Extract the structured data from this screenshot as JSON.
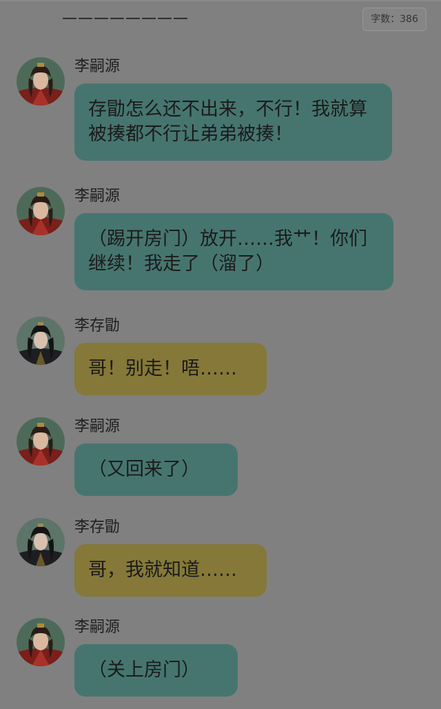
{
  "header": {
    "title_dashes": "————————",
    "word_count": "字数：386"
  },
  "messages": [
    {
      "speaker": "李嗣源",
      "text": "存勖怎么还不出来，不行！我就算被揍都不行让弟弟被揍！",
      "avatar_icon": "avatar-red-robed-man-icon",
      "bubble_color": "#46756f"
    },
    {
      "speaker": "李嗣源",
      "text": "（踢开房门）放开……我艹！你们继续！我走了（溜了）",
      "avatar_icon": "avatar-red-robed-man-icon",
      "bubble_color": "#46756f"
    },
    {
      "speaker": "李存勖",
      "text": "哥！别走！唔……",
      "avatar_icon": "avatar-black-robed-man-icon",
      "bubble_color": "#857838"
    },
    {
      "speaker": "李嗣源",
      "text": "（又回来了）",
      "avatar_icon": "avatar-red-robed-man-icon",
      "bubble_color": "#46756f"
    },
    {
      "speaker": "李存勖",
      "text": "哥，我就知道……",
      "avatar_icon": "avatar-black-robed-man-icon",
      "bubble_color": "#857838"
    },
    {
      "speaker": "李嗣源",
      "text": "（关上房门）",
      "avatar_icon": "avatar-red-robed-man-icon",
      "bubble_color": "#46756f"
    }
  ]
}
